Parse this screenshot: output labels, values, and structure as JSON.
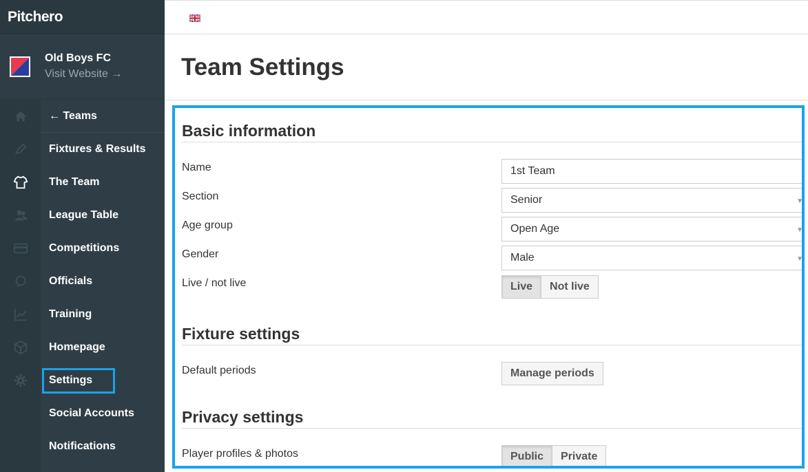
{
  "brand": {
    "name": "Pitchero"
  },
  "club": {
    "name": "Old Boys FC",
    "visit": "Visit Website →"
  },
  "rail_icons": [
    "home-icon",
    "pencil-icon",
    "shirt-icon",
    "people-icon",
    "card-icon",
    "chat-icon",
    "chart-icon",
    "box-icon",
    "gear-icon"
  ],
  "nav": {
    "back": "← Teams",
    "items": [
      "Fixtures & Results",
      "The Team",
      "League Table",
      "Competitions",
      "Officials",
      "Training",
      "Homepage",
      "Settings",
      "Social Accounts",
      "Notifications"
    ],
    "active": "Settings"
  },
  "page": {
    "title": "Team Settings"
  },
  "basic": {
    "title": "Basic information",
    "name_label": "Name",
    "name_value": "1st Team",
    "section_label": "Section",
    "section_value": "Senior",
    "age_label": "Age group",
    "age_value": "Open Age",
    "gender_label": "Gender",
    "gender_value": "Male",
    "live_label": "Live / not live",
    "live_on": "Live",
    "live_off": "Not live"
  },
  "fixture": {
    "title": "Fixture settings",
    "periods_label": "Default periods",
    "periods_button": "Manage periods"
  },
  "privacy": {
    "title": "Privacy settings",
    "profiles_label": "Player profiles & photos",
    "public": "Public",
    "private": "Private"
  },
  "colors": {
    "accent": "#1aa3e8",
    "sidebar": "#2f3e46",
    "rail": "#2a383f"
  }
}
